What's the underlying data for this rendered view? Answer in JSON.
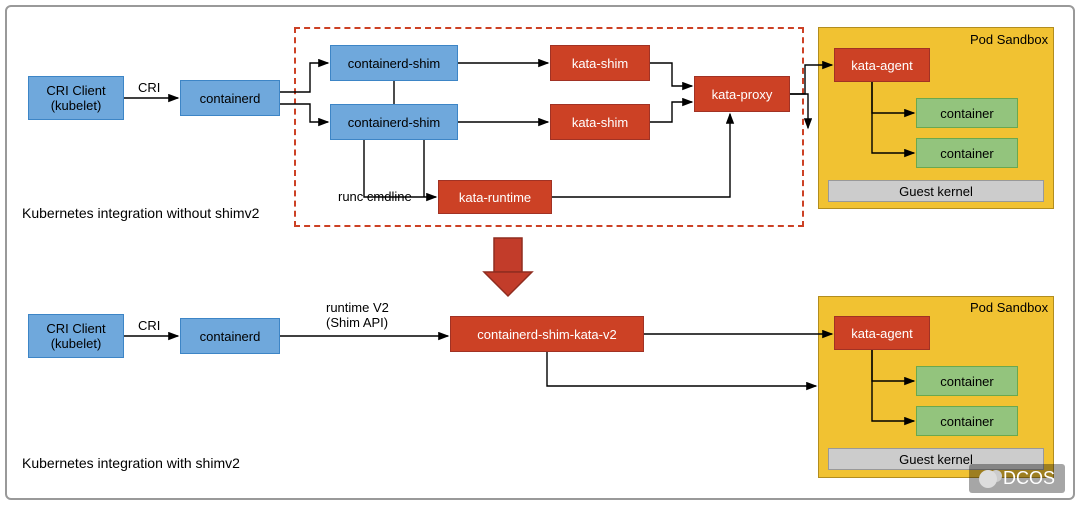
{
  "top": {
    "cri_client": "CRI Client\n(kubelet)",
    "cri_label": "CRI",
    "containerd": "containerd",
    "cshim1": "containerd-shim",
    "cshim2": "containerd-shim",
    "kshim1": "kata-shim",
    "kshim2": "kata-shim",
    "kproxy": "kata-proxy",
    "kruntime": "kata-runtime",
    "runc_label": "runc cmdline",
    "sandbox_title": "Pod Sandbox",
    "kagent": "kata-agent",
    "container1": "container",
    "container2": "container",
    "guest_kernel": "Guest kernel",
    "caption": "Kubernetes integration without shimv2"
  },
  "bottom": {
    "cri_client": "CRI Client\n(kubelet)",
    "cri_label": "CRI",
    "containerd": "containerd",
    "runtime_label": "runtime V2\n(Shim API)",
    "shim_kata_v2": "containerd-shim-kata-v2",
    "sandbox_title": "Pod Sandbox",
    "kagent": "kata-agent",
    "container1": "container",
    "container2": "container",
    "guest_kernel": "Guest kernel",
    "caption": "Kubernetes integration with shimv2"
  },
  "watermark": "DCOS"
}
